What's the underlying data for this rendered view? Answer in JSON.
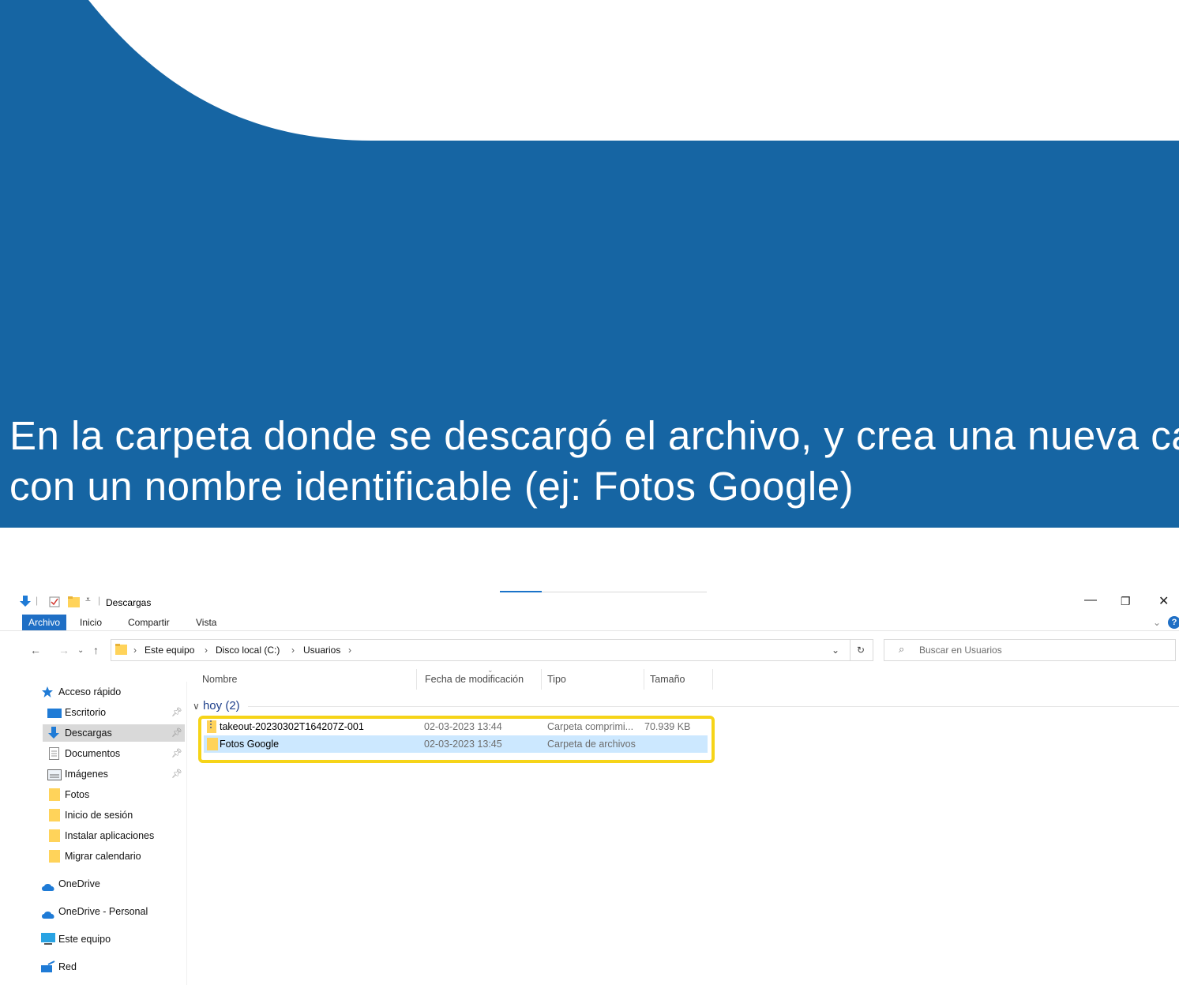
{
  "caption": {
    "line1": "En la carpeta donde se descargó el archivo, y crea una nueva carpeta",
    "line2": "con un nombre identificable (ej: Fotos Google)"
  },
  "colors": {
    "banner": "#1665a3",
    "accent": "#1f6fc5",
    "highlight": "#f6d418",
    "selection": "#cce8ff"
  },
  "window": {
    "title": "Descargas",
    "controls": {
      "minimize": "—",
      "restore": "❐",
      "close": "✕"
    }
  },
  "ribbon": {
    "tabs": [
      "Archivo",
      "Inicio",
      "Compartir",
      "Vista"
    ]
  },
  "address": {
    "path": [
      "Este equipo",
      "Disco local (C:)",
      "Usuarios"
    ],
    "search_placeholder": "Buscar en Usuarios"
  },
  "navpane": {
    "quick_access": "Acceso rápido",
    "items": [
      {
        "label": "Escritorio",
        "icon": "desktop-icon",
        "pinned": true
      },
      {
        "label": "Descargas",
        "icon": "download-icon",
        "pinned": true,
        "selected": true
      },
      {
        "label": "Documentos",
        "icon": "document-icon",
        "pinned": true
      },
      {
        "label": "Imágenes",
        "icon": "pictures-icon",
        "pinned": true
      },
      {
        "label": "Fotos",
        "icon": "folder-icon"
      },
      {
        "label": "Inicio de sesión",
        "icon": "folder-icon"
      },
      {
        "label": "Instalar aplicaciones",
        "icon": "folder-icon"
      },
      {
        "label": "Migrar calendario",
        "icon": "folder-icon"
      }
    ],
    "onedrive": "OneDrive",
    "onedrive_personal": "OneDrive - Personal",
    "this_pc": "Este equipo",
    "network": "Red"
  },
  "filelist": {
    "columns": [
      "Nombre",
      "Fecha de modificación",
      "Tipo",
      "Tamaño"
    ],
    "group": "hoy (2)",
    "rows": [
      {
        "name": "takeout-20230302T164207Z-001",
        "date": "02-03-2023 13:44",
        "type": "Carpeta comprimi...",
        "size": "70.939 KB",
        "icon": "zip-folder-icon"
      },
      {
        "name": "Fotos Google",
        "date": "02-03-2023 13:45",
        "type": "Carpeta de archivos",
        "size": "",
        "icon": "folder-icon",
        "selected": true
      }
    ]
  }
}
